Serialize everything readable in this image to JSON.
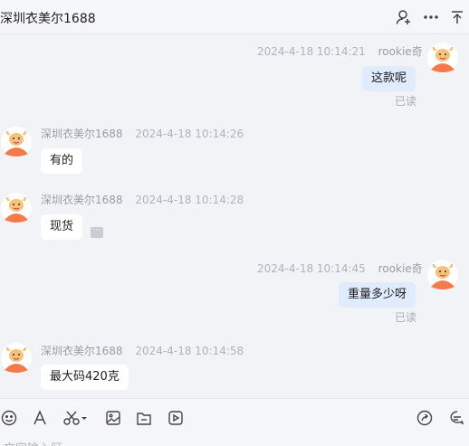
{
  "header": {
    "title": "深圳衣美尔1688"
  },
  "messages": [
    {
      "dir": "out",
      "sender": "rookie奇",
      "time": "2024-4-18 10:14:21",
      "text": "这款呢",
      "status": "已读"
    },
    {
      "dir": "in",
      "sender": "深圳衣美尔1688",
      "time": "2024-4-18 10:14:26",
      "text": "有的"
    },
    {
      "dir": "in",
      "sender": "深圳衣美尔1688",
      "time": "2024-4-18 10:14:28",
      "text": "现货"
    },
    {
      "dir": "out",
      "sender": "rookie奇",
      "time": "2024-4-18 10:14:45",
      "text": "重量多少呀",
      "status": "已读"
    },
    {
      "dir": "in",
      "sender": "深圳衣美尔1688",
      "time": "2024-4-18 10:14:58",
      "text": "最大码420克"
    }
  ],
  "more_chip": "···",
  "input": {
    "placeholder": "文字输入区"
  },
  "colors": {
    "accent": "#e0ebfd",
    "background": "#f2f3f6",
    "avatar_orange": "#f47a4b"
  }
}
